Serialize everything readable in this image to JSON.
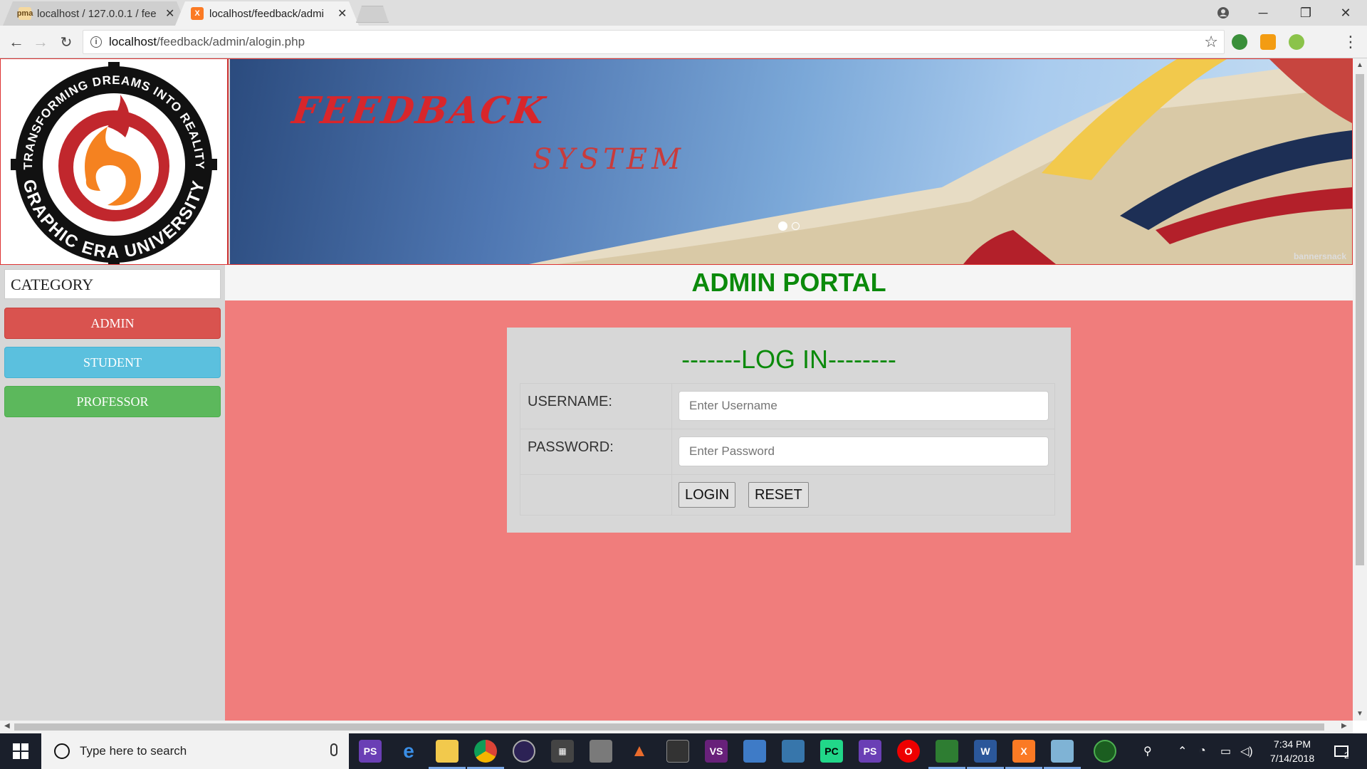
{
  "browser": {
    "tabs": [
      {
        "title": "localhost / 127.0.0.1 / fee",
        "close": "✕"
      },
      {
        "title": "localhost/feedback/admi",
        "close": "✕"
      }
    ],
    "url_host": "localhost",
    "url_path": "/feedback/admin/alogin.php",
    "window_controls": {
      "minimize": "─",
      "maximize": "❐",
      "close": "✕"
    }
  },
  "header": {
    "logo": {
      "ring_text_top": "TRANSFORMING DREAMS INTO REALITY",
      "ring_text_bottom": "GRAPHIC ERA UNIVERSITY"
    },
    "banner": {
      "title": "FEEDBACK",
      "subtitle": "SYSTEM",
      "credit": "bannersnack"
    }
  },
  "sidebar": {
    "heading": "CATEGORY",
    "buttons": [
      {
        "label": "ADMIN",
        "color": "#d9534f"
      },
      {
        "label": "STUDENT",
        "color": "#5bc0de"
      },
      {
        "label": "PROFESSOR",
        "color": "#5cb85c"
      }
    ]
  },
  "main": {
    "portal_title": "ADMIN PORTAL",
    "login": {
      "title": "-------LOG IN--------",
      "username_label": "USERNAME:",
      "username_placeholder": "Enter Username",
      "password_label": "PASSWORD:",
      "password_placeholder": "Enter Password",
      "login_button": "LOGIN",
      "reset_button": "RESET"
    }
  },
  "taskbar": {
    "search_placeholder": "Type here to search",
    "time": "7:34 PM",
    "date": "7/14/2018",
    "notification_count": "2"
  },
  "colors": {
    "content_bg": "#f07d7c",
    "portal_title": "#0b8a0b",
    "header_border": "#d33333"
  }
}
